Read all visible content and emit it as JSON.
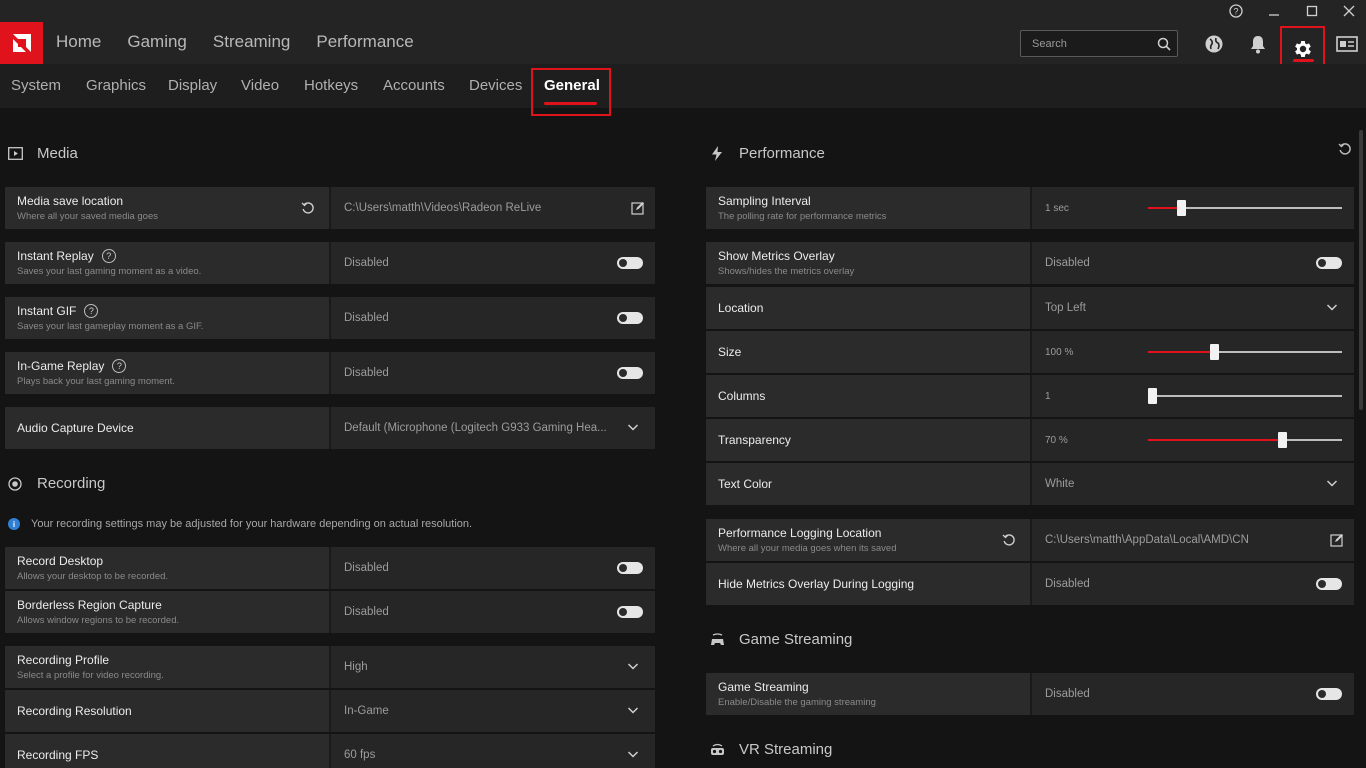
{
  "topnav": {
    "items": [
      "Home",
      "Gaming",
      "Streaming",
      "Performance"
    ],
    "search_placeholder": "Search"
  },
  "subnav": {
    "tabs": [
      "System",
      "Graphics",
      "Display",
      "Video",
      "Hotkeys",
      "Accounts",
      "Devices",
      "General"
    ],
    "active": "General"
  },
  "media": {
    "title": "Media",
    "save_location": {
      "label": "Media save location",
      "sub": "Where all your saved media goes",
      "value": "C:\\Users\\matth\\Videos\\Radeon ReLive"
    },
    "instant_replay": {
      "label": "Instant Replay",
      "sub": "Saves your last gaming moment as a video.",
      "value": "Disabled"
    },
    "instant_gif": {
      "label": "Instant GIF",
      "sub": "Saves your last gameplay moment as a GIF.",
      "value": "Disabled"
    },
    "ingame_replay": {
      "label": "In-Game Replay",
      "sub": "Plays back your last gaming moment.",
      "value": "Disabled"
    },
    "audio_capture": {
      "label": "Audio Capture Device",
      "value": "Default (Microphone (Logitech G933 Gaming Hea..."
    }
  },
  "recording": {
    "title": "Recording",
    "info": "Your recording settings may be adjusted for your hardware depending on actual resolution.",
    "record_desktop": {
      "label": "Record Desktop",
      "sub": "Allows your desktop to be recorded.",
      "value": "Disabled"
    },
    "borderless": {
      "label": "Borderless Region Capture",
      "sub": "Allows window regions to be recorded.",
      "value": "Disabled"
    },
    "profile": {
      "label": "Recording Profile",
      "sub": "Select a profile for video recording.",
      "value": "High"
    },
    "resolution": {
      "label": "Recording Resolution",
      "value": "In-Game"
    },
    "fps": {
      "label": "Recording FPS",
      "value": "60 fps"
    }
  },
  "performance": {
    "title": "Performance",
    "sampling": {
      "label": "Sampling Interval",
      "sub": "The polling rate for performance metrics",
      "value": "1 sec",
      "level": 0.17
    },
    "show_overlay": {
      "label": "Show Metrics Overlay",
      "sub": "Shows/hides the metrics overlay",
      "value": "Disabled"
    },
    "location": {
      "label": "Location",
      "value": "Top Left"
    },
    "size": {
      "label": "Size",
      "value": "100 %",
      "level": 0.34
    },
    "columns": {
      "label": "Columns",
      "value": "1",
      "level": 0.02
    },
    "transparency": {
      "label": "Transparency",
      "value": "70 %",
      "level": 0.69
    },
    "text_color": {
      "label": "Text Color",
      "value": "White"
    },
    "logging_location": {
      "label": "Performance Logging Location",
      "sub": "Where all your media goes when its saved",
      "value": "C:\\Users\\matth\\AppData\\Local\\AMD\\CN"
    },
    "hide_overlay_logging": {
      "label": "Hide Metrics Overlay During Logging",
      "value": "Disabled"
    }
  },
  "game_streaming": {
    "title": "Game Streaming",
    "toggle": {
      "label": "Game Streaming",
      "sub": "Enable/Disable the gaming streaming",
      "value": "Disabled"
    }
  },
  "vr_streaming": {
    "title": "VR Streaming"
  },
  "colors": {
    "accent": "#e0121b",
    "background": "#141414",
    "panel": "#2b2b2b"
  }
}
